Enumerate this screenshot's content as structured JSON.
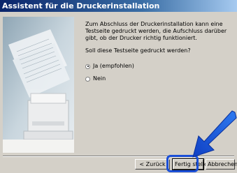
{
  "window": {
    "title": "Assistent für die Druckerinstallation"
  },
  "content": {
    "intro": "Zum Abschluss der Druckerinstallation kann eine Testseite gedruckt werden, die Aufschluss darüber gibt, ob der Drucker richtig funktioniert.",
    "question": "Soll diese Testseite gedruckt werden?",
    "options": [
      {
        "label": "Ja (empfohlen)",
        "selected": true
      },
      {
        "label": "Nein",
        "selected": false
      }
    ]
  },
  "buttons": {
    "back": "< Zurück",
    "finish": "Fertig stellen",
    "cancel": "Abbrechen"
  },
  "colors": {
    "titlebar_start": "#0a246a",
    "highlight": "#1a4fd8",
    "arrow": "#1a5ee0"
  },
  "icons": {
    "sidebar": "printer-illustration",
    "pointer": "arrow-pointer-icon"
  }
}
